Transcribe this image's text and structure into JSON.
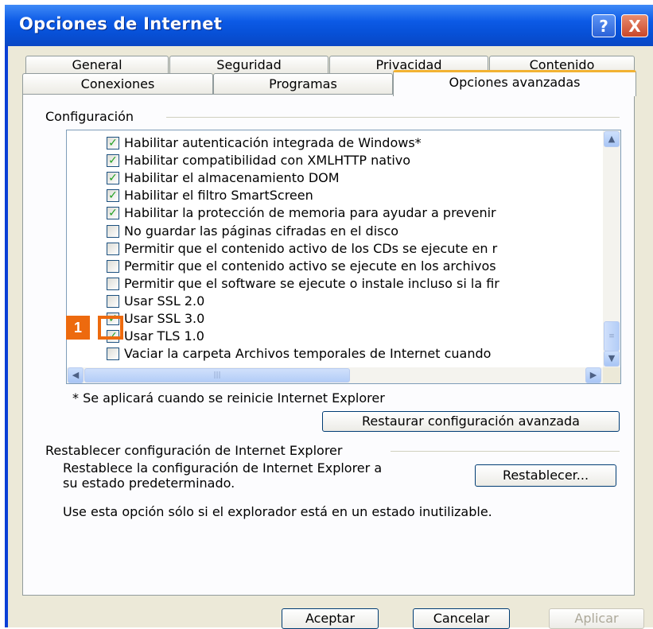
{
  "window": {
    "title": "Opciones de Internet",
    "help_symbol": "?",
    "close_symbol": "X"
  },
  "tabs_row1": [
    "General",
    "Seguridad",
    "Privacidad",
    "Contenido"
  ],
  "tabs_row2": [
    "Conexiones",
    "Programas",
    "Opciones avanzadas"
  ],
  "active_tab": "Opciones avanzadas",
  "settings": {
    "group_label": "Configuración",
    "items": [
      {
        "label": "Habilitar autenticación integrada de Windows*",
        "checked": true
      },
      {
        "label": "Habilitar compatibilidad con XMLHTTP nativo",
        "checked": true
      },
      {
        "label": "Habilitar el almacenamiento DOM",
        "checked": true
      },
      {
        "label": "Habilitar el filtro SmartScreen",
        "checked": true
      },
      {
        "label": "Habilitar la protección de memoria para ayudar a prevenir",
        "checked": true
      },
      {
        "label": "No guardar las páginas cifradas en el disco",
        "checked": false
      },
      {
        "label": "Permitir que el contenido activo de los CDs se ejecute en r",
        "checked": false
      },
      {
        "label": "Permitir que el contenido activo se ejecute en los archivos",
        "checked": false
      },
      {
        "label": "Permitir que el software se ejecute o instale incluso si la fir",
        "checked": false
      },
      {
        "label": "Usar SSL 2.0",
        "checked": false
      },
      {
        "label": "Usar SSL 3.0",
        "checked": true
      },
      {
        "label": "Usar TLS 1.0",
        "checked": true
      },
      {
        "label": "Vaciar la carpeta Archivos temporales de Internet cuando",
        "checked": false
      }
    ],
    "footnote": "* Se aplicará cuando se reinicie Internet Explorer",
    "restore_button": "Restaurar configuración avanzada"
  },
  "reset": {
    "group_label": "Restablecer configuración de Internet Explorer",
    "description_line1": "Restablece la configuración de Internet Explorer a",
    "description_line2": "su estado predeterminado.",
    "button": "Restablecer...",
    "note": "Use esta opción sólo si el explorador está en un estado inutilizable."
  },
  "annotation": {
    "number": "1",
    "color": "#ed6a0e"
  },
  "footer_buttons": {
    "ok": "Aceptar",
    "cancel": "Cancelar",
    "apply": "Aplicar"
  },
  "colors": {
    "titlebar": "#0750d6",
    "dialog": "#ece9d8",
    "check": "#21a121"
  }
}
